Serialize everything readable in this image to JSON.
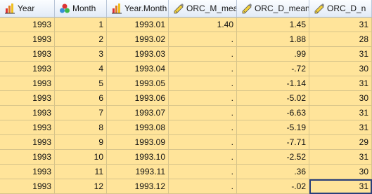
{
  "columns": [
    {
      "label": "Year",
      "icon": "scale-ruler-bar-icon"
    },
    {
      "label": "Month",
      "icon": "nominal-icon"
    },
    {
      "label": "Year.Month",
      "icon": "scale-ruler-bar-icon"
    },
    {
      "label": "ORC_M_mean",
      "icon": "pencil-ruler-icon"
    },
    {
      "label": "ORC_D_mean",
      "icon": "pencil-ruler-icon"
    },
    {
      "label": "ORC_D_n",
      "icon": "pencil-ruler-icon"
    }
  ],
  "rows": [
    [
      "1993",
      "1",
      "1993.01",
      "1.40",
      "1.45",
      "31"
    ],
    [
      "1993",
      "2",
      "1993.02",
      ".",
      "1.88",
      "28"
    ],
    [
      "1993",
      "3",
      "1993.03",
      ".",
      ".99",
      "31"
    ],
    [
      "1993",
      "4",
      "1993.04",
      ".",
      "-.72",
      "30"
    ],
    [
      "1993",
      "5",
      "1993.05",
      ".",
      "-1.14",
      "31"
    ],
    [
      "1993",
      "6",
      "1993.06",
      ".",
      "-5.02",
      "30"
    ],
    [
      "1993",
      "7",
      "1993.07",
      ".",
      "-6.63",
      "31"
    ],
    [
      "1993",
      "8",
      "1993.08",
      ".",
      "-5.19",
      "31"
    ],
    [
      "1993",
      "9",
      "1993.09",
      ".",
      "-7.71",
      "29"
    ],
    [
      "1993",
      "10",
      "1993.10",
      ".",
      "-2.52",
      "31"
    ],
    [
      "1993",
      "11",
      "1993.11",
      ".",
      ".36",
      "30"
    ],
    [
      "1993",
      "12",
      "1993.12",
      ".",
      "-.02",
      "31"
    ]
  ]
}
